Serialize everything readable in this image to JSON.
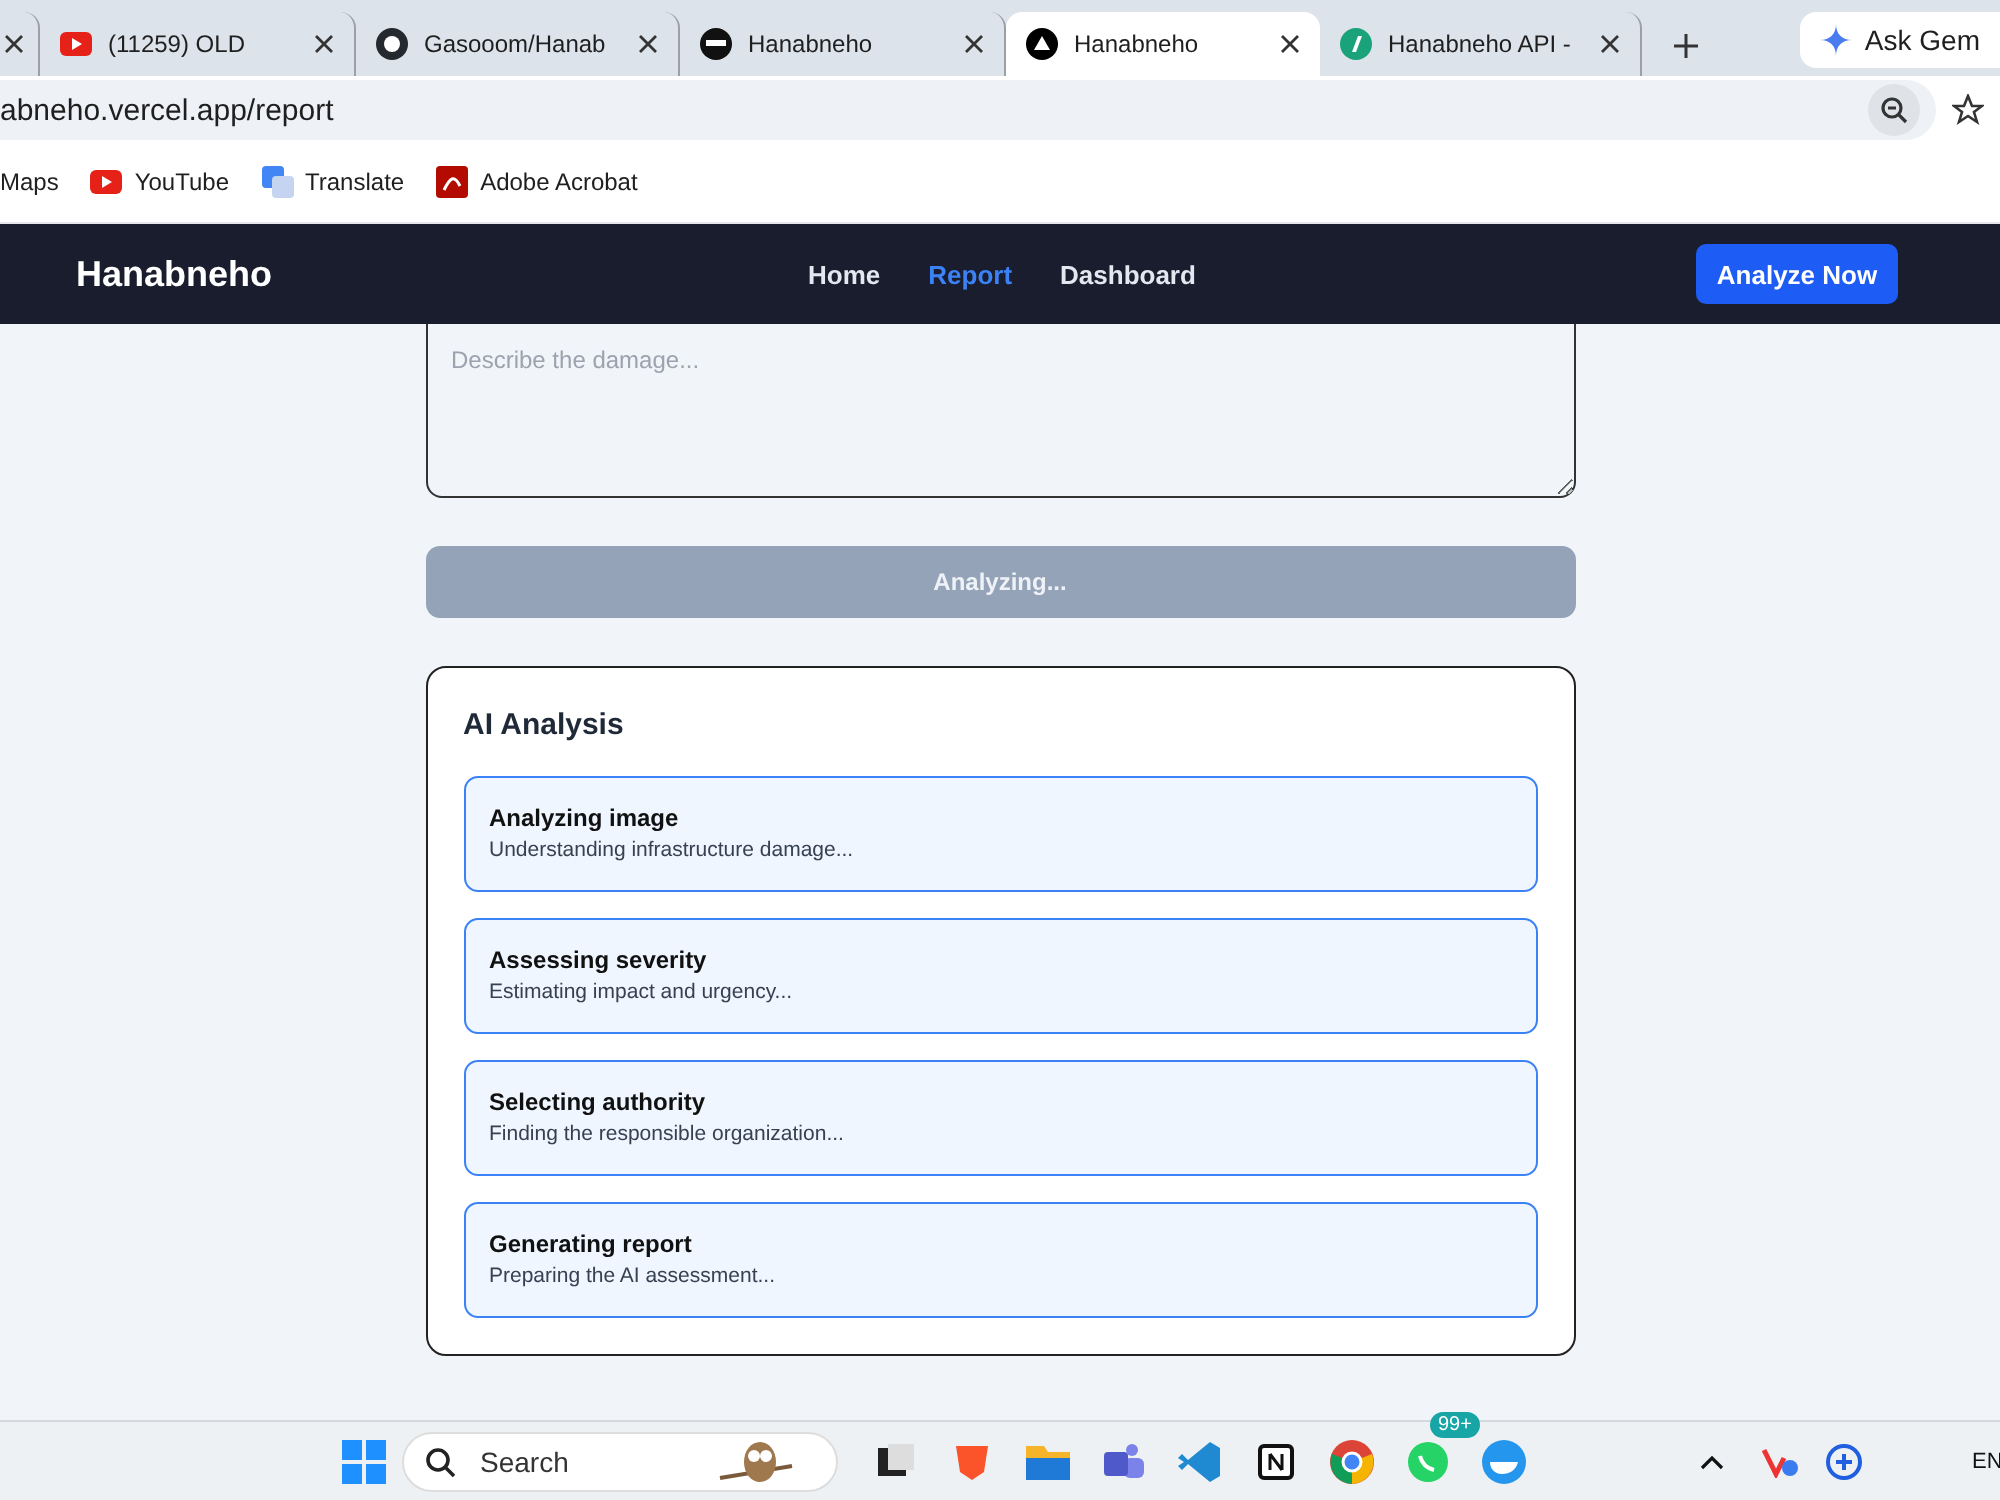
{
  "browser": {
    "tabs": [
      {
        "kind": "close-only",
        "selected": false
      },
      {
        "title": "(11259) OLD",
        "kind": "youtube",
        "selected": false
      },
      {
        "title": "Gasooom/Hanab",
        "kind": "github",
        "selected": false
      },
      {
        "title": "Hanabneho",
        "kind": "dark",
        "selected": false
      },
      {
        "title": "Hanabneho",
        "kind": "triangle",
        "selected": true
      },
      {
        "title": "Hanabneho API -",
        "kind": "green",
        "selected": false
      }
    ],
    "ask": "Ask Gem",
    "address": "abneho.vercel.app/report",
    "bookmarks": [
      {
        "label": "Maps",
        "kind": "none"
      },
      {
        "label": "YouTube",
        "kind": "youtube"
      },
      {
        "label": "Translate",
        "kind": "translate"
      },
      {
        "label": "Adobe Acrobat",
        "kind": "acrobat"
      }
    ]
  },
  "navbar": {
    "brand": "Hanabneho",
    "links": [
      {
        "label": "Home",
        "selected": false
      },
      {
        "label": "Report",
        "selected": true
      },
      {
        "label": "Dashboard",
        "selected": false
      }
    ],
    "cta": "Analyze Now"
  },
  "form": {
    "description": {
      "placeholder": "Describe the damage..."
    },
    "submit": {
      "label": "Analyzing...",
      "disabled": true
    }
  },
  "analysis": {
    "title": "AI Analysis",
    "steps": [
      {
        "title": "Analyzing image",
        "detail": "Understanding infrastructure damage..."
      },
      {
        "title": "Assessing severity",
        "detail": "Estimating impact and urgency..."
      },
      {
        "title": "Selecting authority",
        "detail": "Finding the responsible organization..."
      },
      {
        "title": "Generating report",
        "detail": "Preparing the AI assessment..."
      }
    ]
  },
  "taskbar": {
    "search": {
      "placeholder": "Search"
    },
    "badge": "99+",
    "language": "EN"
  }
}
